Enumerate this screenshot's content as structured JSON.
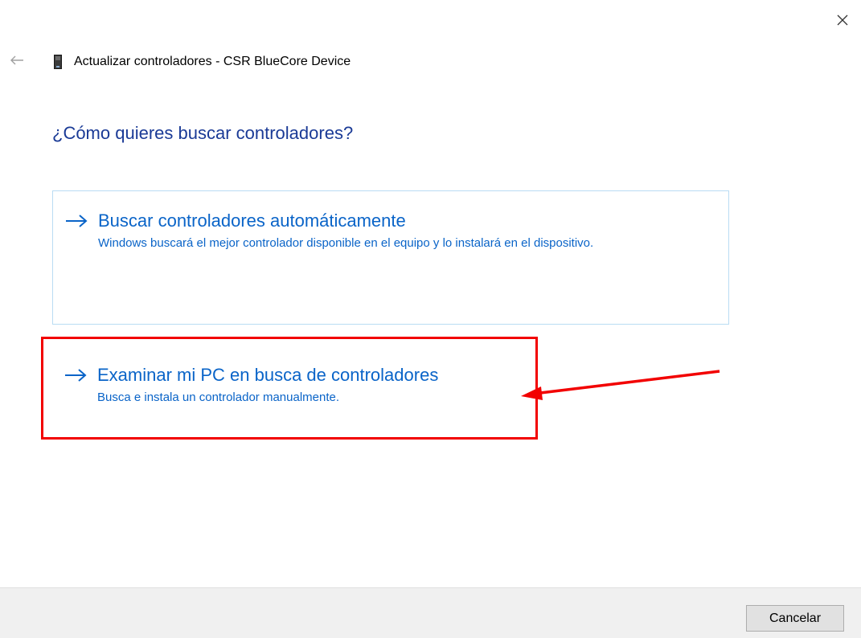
{
  "window": {
    "title": "Actualizar controladores - CSR BlueCore Device"
  },
  "main": {
    "question": "¿Cómo quieres buscar controladores?",
    "options": [
      {
        "title": "Buscar controladores automáticamente",
        "description": "Windows buscará el mejor controlador disponible en el equipo y lo instalará en el dispositivo."
      },
      {
        "title": "Examinar mi PC en busca de controladores",
        "description": "Busca e instala un controlador manualmente."
      }
    ]
  },
  "footer": {
    "cancel_label": "Cancelar"
  },
  "colors": {
    "accent": "#0a64c8",
    "question": "#1a3a96",
    "annotation": "#f20000",
    "option_border": "#b9dcf3"
  },
  "icons": {
    "close": "close-icon",
    "back": "back-arrow-icon",
    "device": "device-icon",
    "option_arrow": "arrow-right-icon"
  }
}
